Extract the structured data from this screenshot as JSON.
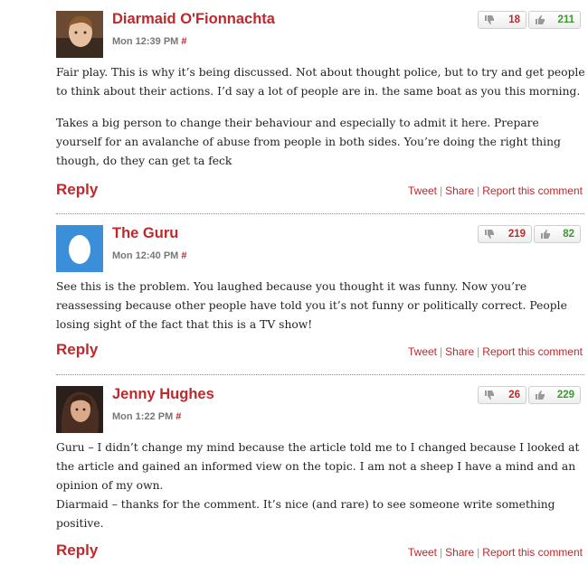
{
  "comments": [
    {
      "author": "Diarmaid O'Fionnachta",
      "time": "Mon 12:39 PM",
      "hash": "#",
      "dislikes": "18",
      "likes": "211",
      "paragraphs": [
        "Fair play. This is why it’s being discussed. Not about thought police, but to try and get people to think about their actions. I’d say a lot of people are in. the same boat as you this morning.",
        "Takes a big person to change their behaviour and especially to admit it here. Prepare yourself for an avalanche of abuse from people in both sides. You’re doing the right thing though, do they can get ta feck"
      ]
    },
    {
      "author": "The Guru",
      "time": "Mon 12:40 PM",
      "hash": "#",
      "dislikes": "219",
      "likes": "82",
      "paragraphs": [
        "See this is the problem. You laughed because you thought it was funny. Now you’re reassessing because other people have told you it’s not funny or politically correct. People losing sight of the fact that this is a TV show!"
      ]
    },
    {
      "author": "Jenny Hughes",
      "time": "Mon 1:22 PM",
      "hash": "#",
      "dislikes": "26",
      "likes": "229",
      "paragraphs": [
        "Guru – I didn’t change my mind because the article told me to I changed because I looked at the article and gained an informed view on the topic. I am not a sheep I have a mind and an opinion of my own.",
        "Diarmaid – thanks for the comment. It’s nice (and rare) to see someone write something positive."
      ]
    }
  ],
  "labels": {
    "reply": "Reply",
    "tweet": "Tweet",
    "share": "Share",
    "report": "Report this comment",
    "sep": "|"
  },
  "colors": {
    "accent": "#c0282b",
    "likes": "#3a9a2e",
    "meta": "#777777",
    "egg_bg": "#3b8fd9"
  }
}
